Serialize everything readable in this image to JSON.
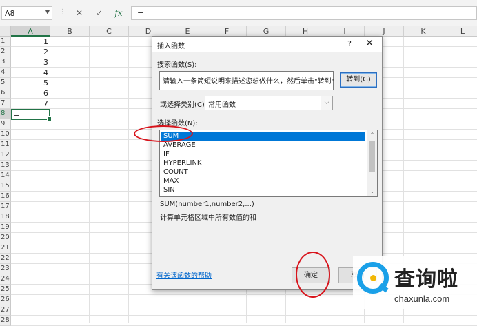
{
  "formula_bar": {
    "name_box": "A8",
    "formula": "=",
    "icons": [
      "cancel-icon",
      "enter-icon",
      "insert-function-icon"
    ],
    "fx_label": "fx"
  },
  "grid": {
    "columns": [
      "A",
      "B",
      "C",
      "D",
      "E",
      "F",
      "G",
      "H",
      "I",
      "J",
      "K",
      "L"
    ],
    "rows": [
      "1",
      "2",
      "3",
      "4",
      "5",
      "6",
      "7",
      "8",
      "9",
      "10",
      "11",
      "12",
      "13",
      "14",
      "15",
      "16",
      "17",
      "18",
      "19",
      "20",
      "21",
      "22",
      "23",
      "24",
      "25",
      "26",
      "27",
      "28"
    ],
    "column_a_values": [
      "1",
      "2",
      "3",
      "4",
      "5",
      "6",
      "7"
    ],
    "active_cell": "A8",
    "active_cell_value": "="
  },
  "dialog": {
    "title": "插入函数",
    "help": "?",
    "close": "✕",
    "search_label": "搜索函数(S):",
    "search_value": "请输入一条简短说明来描述您想做什么，然后单击\"转到\"",
    "goto_label": "转到(G)",
    "category_label": "或选择类别(C):",
    "category_value": "常用函数",
    "function_label": "选择函数(N):",
    "functions": [
      "SUM",
      "AVERAGE",
      "IF",
      "HYPERLINK",
      "COUNT",
      "MAX",
      "SIN"
    ],
    "selected_function": "SUM",
    "syntax": "SUM(number1,number2,...)",
    "description": "计算单元格区域中所有数值的和",
    "help_link": "有关该函数的帮助",
    "ok_label": "确定",
    "cancel_label": "取消"
  },
  "watermark": {
    "brand": "查询啦",
    "url": "chaxunla.com"
  },
  "colors": {
    "excel_green": "#217346",
    "selection_blue": "#0078d7",
    "annotation_red": "#d8141c",
    "watermark_blue": "#1aa0e8"
  }
}
